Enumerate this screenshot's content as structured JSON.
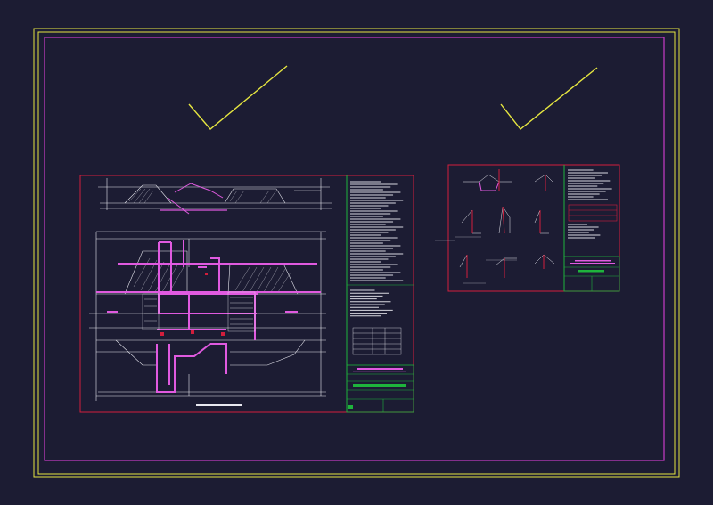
{
  "canvas": {
    "background": "#1c1c33",
    "colors": {
      "yellow": "#e6e640",
      "magenta": "#c83cc8",
      "red": "#d21e3c",
      "white": "#e8e8f0",
      "green": "#1eb43c",
      "pink": "#e05ae0",
      "cyan": "#3cc8c8"
    }
  },
  "marks": [
    {
      "name": "checkmark-left",
      "type": "check-icon"
    },
    {
      "name": "checkmark-right",
      "type": "check-icon"
    }
  ],
  "sheets": [
    {
      "name": "main-drawing-sheet",
      "title_block_lines": 3
    },
    {
      "name": "detail-drawing-sheet",
      "title_block_lines": 2
    }
  ]
}
